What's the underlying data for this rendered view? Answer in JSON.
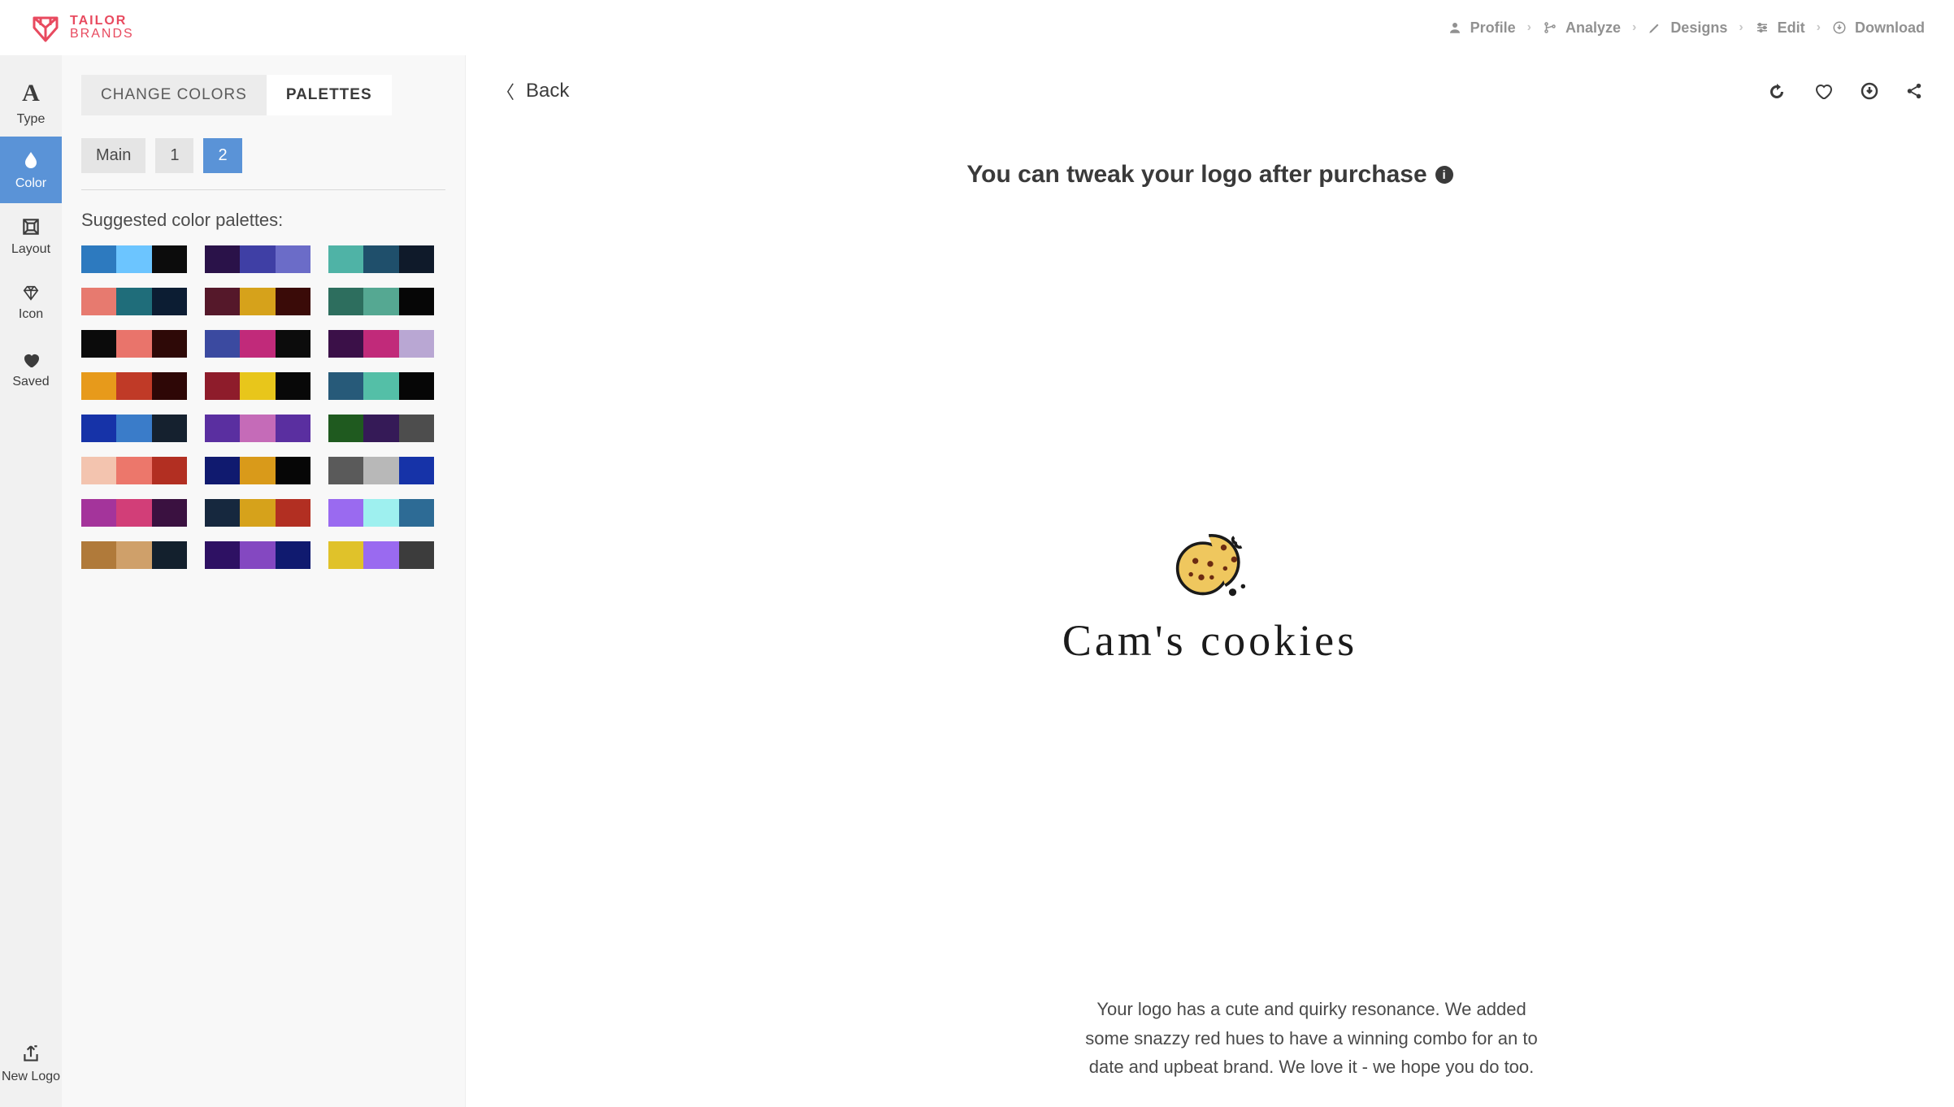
{
  "brand": {
    "line1": "TAILOR",
    "line2": "BRANDS"
  },
  "crumbs": [
    {
      "icon": "user",
      "label": "Profile"
    },
    {
      "icon": "branch",
      "label": "Analyze"
    },
    {
      "icon": "pencil",
      "label": "Designs"
    },
    {
      "icon": "sliders",
      "label": "Edit"
    },
    {
      "icon": "download-circle",
      "label": "Download"
    }
  ],
  "rail": {
    "items": [
      {
        "icon": "type",
        "label": "Type"
      },
      {
        "icon": "drop",
        "label": "Color",
        "active": true
      },
      {
        "icon": "layout",
        "label": "Layout"
      },
      {
        "icon": "diamond",
        "label": "Icon"
      },
      {
        "icon": "heart",
        "label": "Saved"
      }
    ],
    "bottom": {
      "icon": "export",
      "label": "New Logo"
    }
  },
  "tabs": {
    "change": "CHANGE COLORS",
    "palettes": "PALETTES",
    "active": "palettes"
  },
  "chips": {
    "items": [
      "Main",
      "1",
      "2"
    ],
    "active": 2
  },
  "suggested_title": "Suggested color palettes:",
  "palettes": [
    [
      [
        "#2d7abf",
        "#6cc5ff",
        "#0c0c0c"
      ],
      [
        "#2a1249",
        "#3f3fa5",
        "#6b6cc8"
      ],
      [
        "#4fb3a6",
        "#1f4f6b",
        "#0f1a2a"
      ]
    ],
    [
      [
        "#e77a6f",
        "#1f6d7a",
        "#0c1d33"
      ],
      [
        "#55182a",
        "#d6a21b",
        "#3a0b08"
      ],
      [
        "#2d6e5e",
        "#55a892",
        "#060606"
      ]
    ],
    [
      [
        "#0b0b0b",
        "#e9746b",
        "#2e0907"
      ],
      [
        "#3b4aa0",
        "#c12a7a",
        "#0c0c0c"
      ],
      [
        "#3b1048",
        "#c12a7a",
        "#b9a7d3"
      ]
    ],
    [
      [
        "#e79a1b",
        "#c03a27",
        "#2e0706"
      ],
      [
        "#8e1c2b",
        "#e8c61b",
        "#080808"
      ],
      [
        "#275a79",
        "#54bfa7",
        "#060606"
      ]
    ],
    [
      [
        "#1633a8",
        "#3a7cc9",
        "#15212f"
      ],
      [
        "#5a2fa0",
        "#c56bb8",
        "#5a2fa0"
      ],
      [
        "#1f5a1f",
        "#351a57",
        "#4d4d4d"
      ]
    ],
    [
      [
        "#f3c4af",
        "#ec776b",
        "#b22f22"
      ],
      [
        "#101a6f",
        "#d99a1a",
        "#060606"
      ],
      [
        "#5a5a5a",
        "#b8b8b8",
        "#1633a8"
      ]
    ],
    [
      [
        "#a4349b",
        "#d23e78",
        "#3a1140"
      ],
      [
        "#16283e",
        "#d6a21b",
        "#b22f22"
      ],
      [
        "#9a6af0",
        "#9ef0ef",
        "#2d6b95"
      ]
    ],
    [
      [
        "#b07a3a",
        "#cfa06a",
        "#13202d"
      ],
      [
        "#2e1163",
        "#8448c1",
        "#101a6f"
      ],
      [
        "#e0c22a",
        "#9a6af0",
        "#3c3c3c"
      ]
    ]
  ],
  "preview": {
    "back": "Back",
    "headline": "You can tweak your logo after purchase",
    "logo_text": "Cam's cookies",
    "description": "Your logo has a cute and quirky resonance. We added some snazzy red hues to have a winning combo for an to date and upbeat brand. We love it - we hope you do too."
  }
}
